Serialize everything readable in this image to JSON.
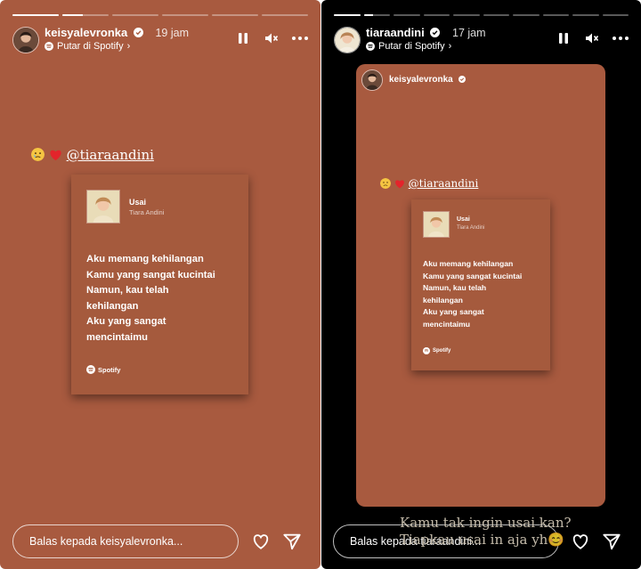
{
  "left_story": {
    "username": "keisyalevronka",
    "time": "19 jam",
    "spotify_line": "Putar di Spotify",
    "chevron": "›",
    "progress": [
      1.0,
      0.45,
      0,
      0,
      0,
      0
    ],
    "mention": {
      "emojis": [
        "sad-face-emoji",
        "red-heart-emoji"
      ],
      "handle": "@tiaraandini"
    },
    "card": {
      "song_title": "Usai",
      "artist": "Tiara Andini",
      "lyrics": [
        "Aku memang kehilangan",
        "Kamu yang sangat kucintai",
        "Namun, kau telah",
        "kehilangan",
        "Aku yang sangat",
        "mencintaimu"
      ],
      "logo_text": "Spotify"
    },
    "reply_placeholder": "Balas kepada keisyalevronka..."
  },
  "right_story": {
    "username": "tiaraandini",
    "time": "17 jam",
    "spotify_line": "Putar di Spotify",
    "chevron": "›",
    "progress": [
      1.0,
      0.35,
      0,
      0,
      0,
      0,
      0,
      0,
      0,
      0
    ],
    "inner": {
      "username": "keisyalevronka",
      "mention_handle": "@tiaraandini",
      "card": {
        "song_title": "Usai",
        "artist": "Tiara Andini",
        "lyrics": [
          "Aku memang kehilangan",
          "Kamu yang sangat kucintai",
          "Namun, kau telah",
          "kehilangan",
          "Aku yang sangat",
          "mencintaimu"
        ],
        "logo_text": "Spotify"
      }
    },
    "caption_lines": [
      "Kamu tak ingin usai kan?",
      "Tiapkau usai in aja yh😊"
    ],
    "reply_placeholder": "Balas kepada tiaraandini..."
  },
  "icons": [
    "verified-icon",
    "pause-icon",
    "mute-icon",
    "more-icon",
    "heart-icon",
    "send-icon",
    "spotify-icon"
  ],
  "colors": {
    "story_bg": "#a85a3f",
    "card_bg": "#a55a3d",
    "frame_bg": "#000000"
  }
}
